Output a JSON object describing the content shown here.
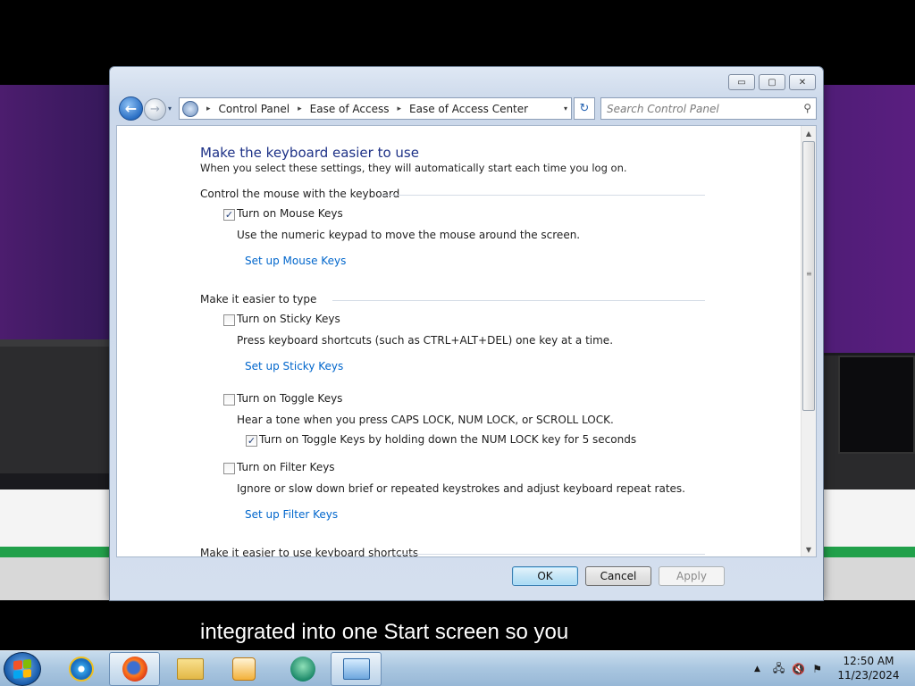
{
  "window": {
    "caption_buttons": {
      "minimize": "▭",
      "maximize": "▢",
      "close": "✕"
    },
    "nav": {
      "back_icon": "←",
      "forward_icon": "→",
      "history_dropdown_icon": "▾",
      "breadcrumbs": [
        "Control Panel",
        "Ease of Access",
        "Ease of Access Center"
      ],
      "crumb_separator": "▸",
      "address_dropdown_icon": "▾",
      "refresh_icon": "↻",
      "search_placeholder": "Search Control Panel",
      "search_icon": "⚲"
    },
    "page": {
      "title": "Make the keyboard easier to use",
      "subtitle": "When you select these settings, they will automatically start each time you log on.",
      "sections": [
        {
          "heading": "Control the mouse with the keyboard",
          "options": [
            {
              "checkbox_label": "Turn on Mouse Keys",
              "checked": true,
              "description": "Use the numeric keypad to move the mouse around the screen.",
              "link": "Set up Mouse Keys"
            }
          ]
        },
        {
          "heading": "Make it easier to type",
          "options": [
            {
              "checkbox_label": "Turn on Sticky Keys",
              "checked": false,
              "description": "Press keyboard shortcuts (such as CTRL+ALT+DEL) one key at a time.",
              "link": "Set up Sticky Keys"
            },
            {
              "checkbox_label": "Turn on Toggle Keys",
              "checked": false,
              "description": "Hear a tone when you press CAPS LOCK, NUM LOCK, or SCROLL LOCK.",
              "sub_checkbox_label": "Turn on Toggle Keys by holding down the NUM LOCK key for 5 seconds",
              "sub_checked": true
            },
            {
              "checkbox_label": "Turn on Filter Keys",
              "checked": false,
              "description": "Ignore or slow down brief or repeated keystrokes and adjust keyboard repeat rates.",
              "link": "Set up Filter Keys"
            }
          ]
        },
        {
          "heading": "Make it easier to use keyboard shortcuts"
        }
      ],
      "check_mark": "✓"
    },
    "buttons": {
      "ok": "OK",
      "cancel": "Cancel",
      "apply": "Apply"
    },
    "scroll": {
      "up_icon": "▲",
      "down_icon": "▼",
      "grip": "≡"
    }
  },
  "subtitle_caption": "integrated into one Start screen so you",
  "taskbar": {
    "items": [
      "start-button",
      "internet-explorer",
      "firefox",
      "windows-explorer",
      "media-player",
      "ease-of-access-app",
      "control-panel"
    ],
    "clock": {
      "time": "12:50 AM",
      "date": "11/23/2024"
    },
    "tray": {
      "show_hidden": "▲",
      "network": "🖧",
      "volume": "🔇",
      "action_center": "⚑"
    }
  },
  "colors": {
    "title_blue": "#1e3287",
    "link_blue": "#0066cc",
    "taskbar": "#a9c6e0"
  }
}
